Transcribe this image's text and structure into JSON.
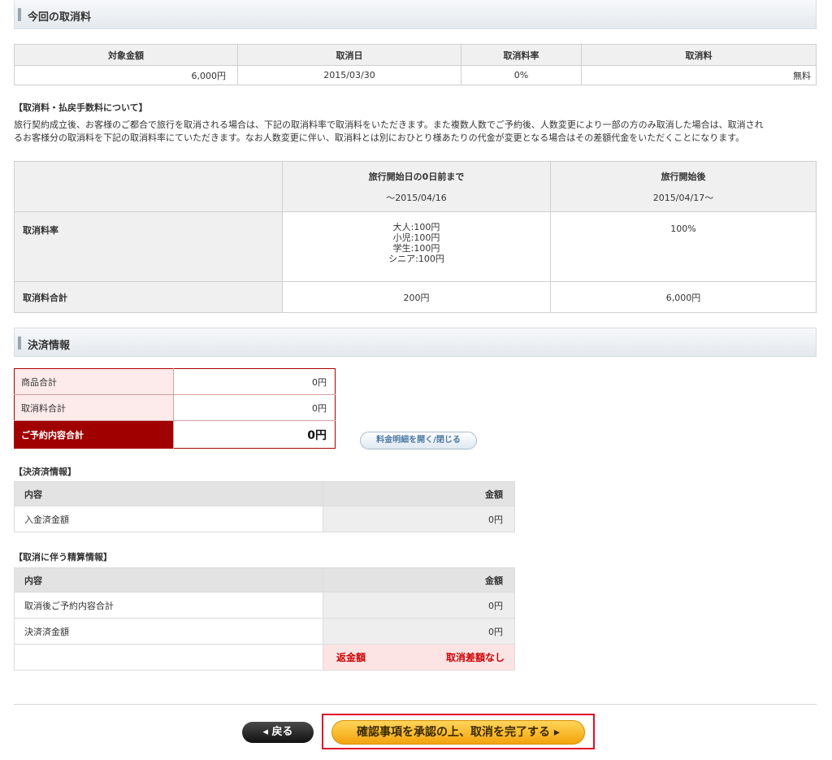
{
  "cancel_section": {
    "title": "今回の取消料",
    "headers": [
      "対象金額",
      "取消日",
      "取消料率",
      "取消料"
    ],
    "row": [
      "6,000円",
      "2015/03/30",
      "0%",
      "無料"
    ]
  },
  "fee_note": {
    "heading": "【取消料・払戻手数料について】",
    "line1": "旅行契約成立後、お客様のご都合で旅行を取消される場合は、下記の取消料率で取消料をいただきます。また複数人数でご予約後、人数変更により一部の方のみ取消した場合は、取消され",
    "line2": "るお客様分の取消料を下記の取消料率にていただきます。なお人数変更に伴い、取消料とは別におひとり様あたりの代金が変更となる場合はその差額代金をいただくことになります。"
  },
  "policy": {
    "col1_title": "旅行開始日の0日前まで",
    "col1_sub": "～2015/04/16",
    "col2_title": "旅行開始後",
    "col2_sub": "2015/04/17～",
    "rate_label": "取消料率",
    "rate_col1": [
      "大人:100円",
      "小児:100円",
      "学生:100円",
      "シニア:100円"
    ],
    "rate_col2": "100%",
    "total_label": "取消料合計",
    "total_col1": "200円",
    "total_col2": "6,000円"
  },
  "payment": {
    "title": "決済情報",
    "rows": [
      {
        "label": "商品合計",
        "value": "0円"
      },
      {
        "label": "取消料合計",
        "value": "0円"
      },
      {
        "label": "ご予約内容合計",
        "value": "0円"
      }
    ],
    "toggle_label": "料金明細を開く/閉じる"
  },
  "settled": {
    "heading": "【決済済情報】",
    "col_content": "内容",
    "col_amount": "金額",
    "rows": [
      {
        "label": "入金済金額",
        "value": "0円"
      }
    ]
  },
  "settlement": {
    "heading": "【取消に伴う精算情報】",
    "col_content": "内容",
    "col_amount": "金額",
    "rows": [
      {
        "label": "取消後ご予約内容合計",
        "value": "0円"
      },
      {
        "label": "決済済金額",
        "value": "0円"
      }
    ],
    "refund_label": "返金額",
    "refund_value": "取消差額なし"
  },
  "actions": {
    "back_label": "◂ 戻る",
    "confirm_label": "確認事項を承認の上、取消を完了する ▸"
  }
}
